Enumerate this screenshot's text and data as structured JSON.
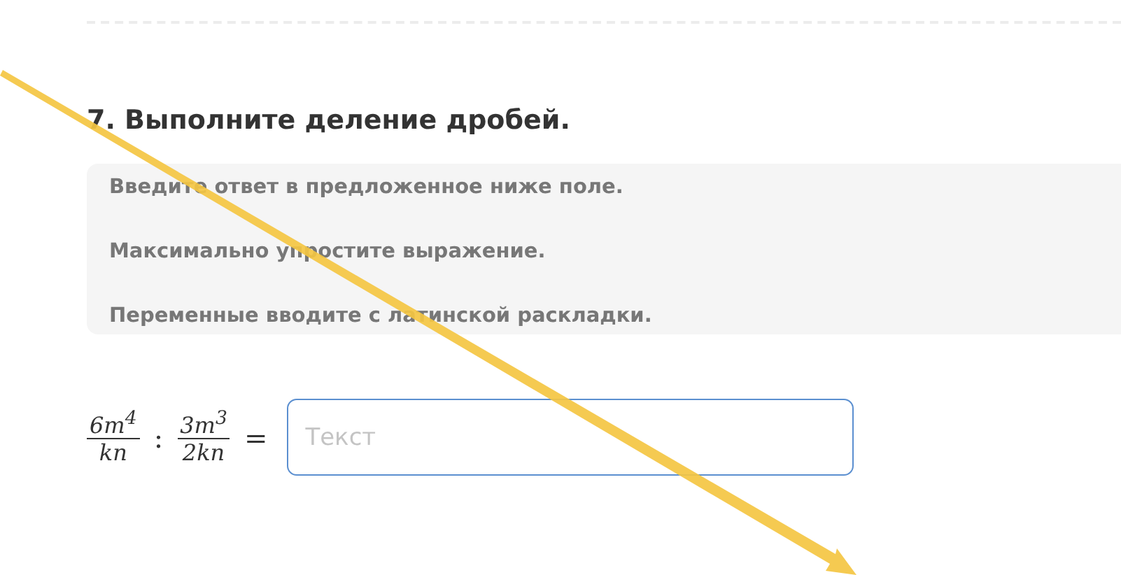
{
  "task": {
    "title": "7. Выполните деление дробей.",
    "hints": [
      "Введите ответ в предложенное ниже поле.",
      "Максимально упростите выражение.",
      "Переменные вводите с латинской раскладки."
    ],
    "expression": {
      "fractions": [
        {
          "numerator": "6m$^{4}$",
          "denominator": "kn"
        },
        {
          "numerator": "3m$^{3}$",
          "denominator": "2kn"
        }
      ],
      "operator": ":",
      "equals": "="
    },
    "answer": {
      "placeholder": "Текст",
      "focused": true
    }
  }
}
